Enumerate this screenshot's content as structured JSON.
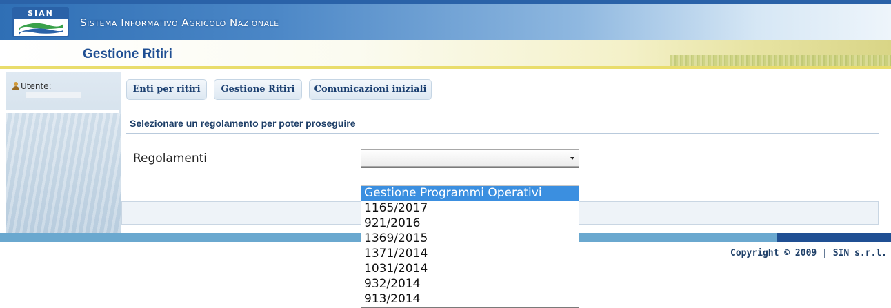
{
  "header": {
    "logo_text": "SIAN",
    "system_title": "Sistema Informativo Agricolo Nazionale",
    "page_title": "Gestione Ritiri"
  },
  "sidebar": {
    "user_label": "Utente:"
  },
  "tabs": [
    {
      "label": "Enti per ritiri"
    },
    {
      "label": "Gestione Ritiri"
    },
    {
      "label": "Comunicazioni iniziali"
    }
  ],
  "main": {
    "instruction": "Selezionare un regolamento per poter proseguire",
    "regolamenti_label": "Regolamenti",
    "regolamenti_value": "",
    "dropdown_options": [
      "Gestione Programmi Operativi",
      "1165/2017",
      "921/2016",
      "1369/2015",
      "1371/2014",
      "1031/2014",
      "932/2014",
      "913/2014"
    ],
    "selected_option": "Gestione Programmi Operativi"
  },
  "footer": {
    "copyright": "Copyright © 2009 | SIN s.r.l."
  },
  "colors": {
    "brand_blue": "#1f4f93",
    "highlight": "#3b8fe0"
  }
}
